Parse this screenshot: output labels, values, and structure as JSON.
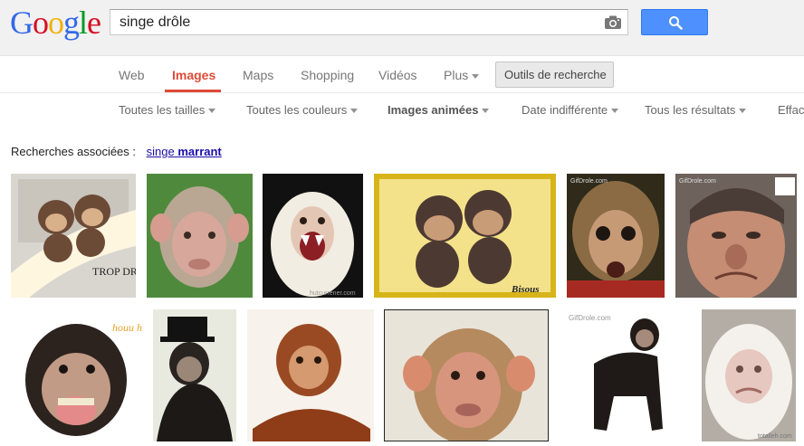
{
  "header": {
    "logo": {
      "letters": [
        "G",
        "o",
        "o",
        "g",
        "l",
        "e"
      ],
      "colors": [
        "#3369e8",
        "#d50f25",
        "#eeb211",
        "#3369e8",
        "#009925",
        "#d50f25"
      ]
    },
    "search": {
      "value": "singe drôle"
    },
    "icons": {
      "camera": "camera-icon",
      "search": "search-icon"
    },
    "accent": "#4d90fe"
  },
  "tabs": {
    "items": [
      {
        "label": "Web",
        "active": false
      },
      {
        "label": "Images",
        "active": true
      },
      {
        "label": "Maps",
        "active": false
      },
      {
        "label": "Shopping",
        "active": false
      },
      {
        "label": "Vidéos",
        "active": false
      },
      {
        "label": "Plus",
        "active": false
      }
    ],
    "tools_label": "Outils de recherche"
  },
  "filters": [
    {
      "label": "Toutes les tailles"
    },
    {
      "label": "Toutes les couleurs"
    },
    {
      "label": "Images animées"
    },
    {
      "label": "Date indifférente"
    },
    {
      "label": "Tous les résultats"
    },
    {
      "label": "Effac"
    }
  ],
  "related": {
    "prefix": "Recherches associées :",
    "link_plain": "singe",
    "link_bold": "marrant"
  },
  "results": {
    "row1": [
      {
        "subject": "two baby monkeys cartoon",
        "caption": "TROP DROLE"
      },
      {
        "subject": "baby macaque face"
      },
      {
        "subject": "capuchin monkey screaming",
        "caption": "hutcurrener.com"
      },
      {
        "subject": "two baby chimps on gold background",
        "caption": "Bisous"
      },
      {
        "subject": "baby monkey surprised face",
        "caption": "GifDrole.com"
      },
      {
        "subject": "man making funny face",
        "caption": "GifDrole.com"
      }
    ],
    "row2": [
      {
        "subject": "chimpanzee laughing",
        "caption": "houu hin hin"
      },
      {
        "subject": "chimpanzee in top hat"
      },
      {
        "subject": "baby orangutan"
      },
      {
        "subject": "macaque face close-up"
      },
      {
        "subject": "standing chimpanzee",
        "caption": "GifDrole.com"
      },
      {
        "subject": "white gorilla",
        "caption": "totalleh.com"
      }
    ]
  }
}
